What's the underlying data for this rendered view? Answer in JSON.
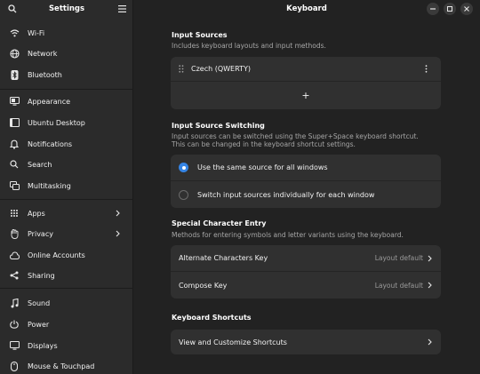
{
  "sidebar": {
    "title": "Settings",
    "items": [
      {
        "label": "Wi-Fi",
        "icon": "wifi-icon"
      },
      {
        "label": "Network",
        "icon": "network-icon"
      },
      {
        "label": "Bluetooth",
        "icon": "bluetooth-icon"
      },
      {
        "label": "Appearance",
        "icon": "appearance-icon"
      },
      {
        "label": "Ubuntu Desktop",
        "icon": "ubuntu-desktop-icon"
      },
      {
        "label": "Notifications",
        "icon": "bell-icon"
      },
      {
        "label": "Search",
        "icon": "search-icon"
      },
      {
        "label": "Multitasking",
        "icon": "multitasking-icon"
      },
      {
        "label": "Apps",
        "icon": "apps-grid-icon"
      },
      {
        "label": "Privacy",
        "icon": "hand-icon"
      },
      {
        "label": "Online Accounts",
        "icon": "online-accounts-icon"
      },
      {
        "label": "Sharing",
        "icon": "share-icon"
      },
      {
        "label": "Sound",
        "icon": "music-note-icon"
      },
      {
        "label": "Power",
        "icon": "power-icon"
      },
      {
        "label": "Displays",
        "icon": "display-icon"
      },
      {
        "label": "Mouse & Touchpad",
        "icon": "mouse-icon"
      }
    ]
  },
  "window": {
    "title": "Keyboard"
  },
  "input_sources": {
    "title": "Input Sources",
    "description": "Includes keyboard layouts and input methods.",
    "source_label": "Czech (QWERTY)",
    "add_label": "+"
  },
  "switching": {
    "title": "Input Source Switching",
    "description_1": "Input sources can be switched using the Super+Space keyboard shortcut.",
    "description_2": "This can be changed in the keyboard shortcut settings.",
    "option_same": "Use the same source for all windows",
    "option_individual": "Switch input sources individually for each window",
    "selected": "same"
  },
  "special_chars": {
    "title": "Special Character Entry",
    "description": "Methods for entering symbols and letter variants using the keyboard.",
    "alternate_label": "Alternate Characters Key",
    "alternate_value": "Layout default",
    "compose_label": "Compose Key",
    "compose_value": "Layout default"
  },
  "shortcuts": {
    "title": "Keyboard Shortcuts",
    "view_label": "View and Customize Shortcuts"
  },
  "colors": {
    "accent": "#3584e4",
    "sidebar_bg": "#2b2b2b",
    "main_bg": "#222222",
    "card_bg": "#303030"
  }
}
